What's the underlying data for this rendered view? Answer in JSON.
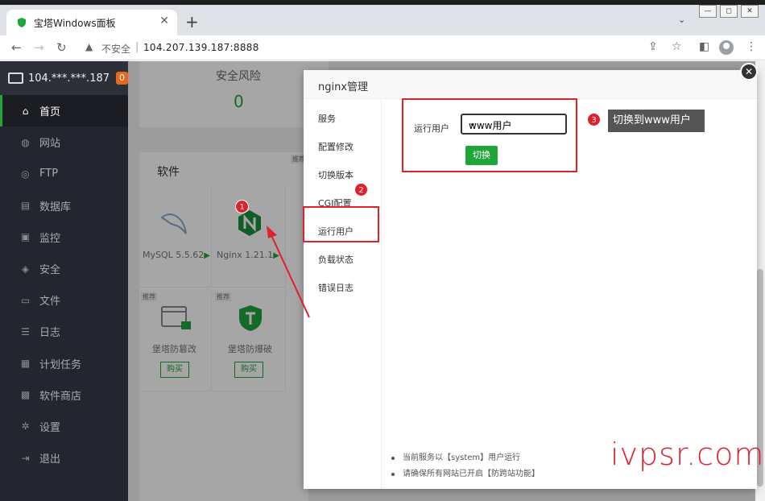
{
  "browser": {
    "tab_title": "宝塔Windows面板",
    "tab_close": "✕",
    "new_tab": "+",
    "tab_menu": "⌄",
    "insecure_label": "不安全",
    "url": "104.207.139.187:8888"
  },
  "sidebar": {
    "server_ip": "104.***.***.187",
    "badge_count": "0",
    "items": [
      {
        "label": "首页",
        "icon": "home-icon",
        "glyph": "⌂"
      },
      {
        "label": "网站",
        "icon": "globe-icon",
        "glyph": "◍"
      },
      {
        "label": "FTP",
        "icon": "ftp-icon",
        "glyph": "◎"
      },
      {
        "label": "数据库",
        "icon": "database-icon",
        "glyph": "▤"
      },
      {
        "label": "监控",
        "icon": "monitor-icon",
        "glyph": "▣"
      },
      {
        "label": "安全",
        "icon": "shield-icon",
        "glyph": "◈"
      },
      {
        "label": "文件",
        "icon": "folder-icon",
        "glyph": "▭"
      },
      {
        "label": "日志",
        "icon": "log-icon",
        "glyph": "☰"
      },
      {
        "label": "计划任务",
        "icon": "calendar-icon",
        "glyph": "▦"
      },
      {
        "label": "软件商店",
        "icon": "apps-icon",
        "glyph": "▩"
      },
      {
        "label": "设置",
        "icon": "gear-icon",
        "glyph": "✲"
      },
      {
        "label": "退出",
        "icon": "logout-icon",
        "glyph": "⇥"
      }
    ]
  },
  "main": {
    "risk_title": "安全风险",
    "risk_value": "0",
    "software_title": "软件",
    "recommend": "推荐",
    "apps": [
      {
        "name": "MySQL 5.5.62"
      },
      {
        "name": "Nginx 1.21.1"
      }
    ],
    "products": [
      {
        "name": "堡塔防篡改",
        "buy": "购买"
      },
      {
        "name": "堡塔防爆破",
        "buy": "购买"
      }
    ]
  },
  "modal": {
    "title": "nginx管理",
    "nav": [
      "服务",
      "配置修改",
      "切换版本",
      "CGI配置",
      "运行用户",
      "负载状态",
      "错误日志"
    ],
    "run_user_label": "运行用户",
    "run_user_value": "www用户",
    "switch_button": "切换",
    "notes": [
      "当前服务以【system】用户运行",
      "请确保所有网站已开启【防跨站功能】"
    ]
  },
  "annotations": {
    "n1": "1",
    "n2": "2",
    "n3": "3",
    "tip": "切换到www用户"
  },
  "watermark": "ivpsr.com",
  "colors": {
    "accent": "#20a53a",
    "annotation_red": "#e0202a",
    "sidebar_bg": "#23262e"
  }
}
